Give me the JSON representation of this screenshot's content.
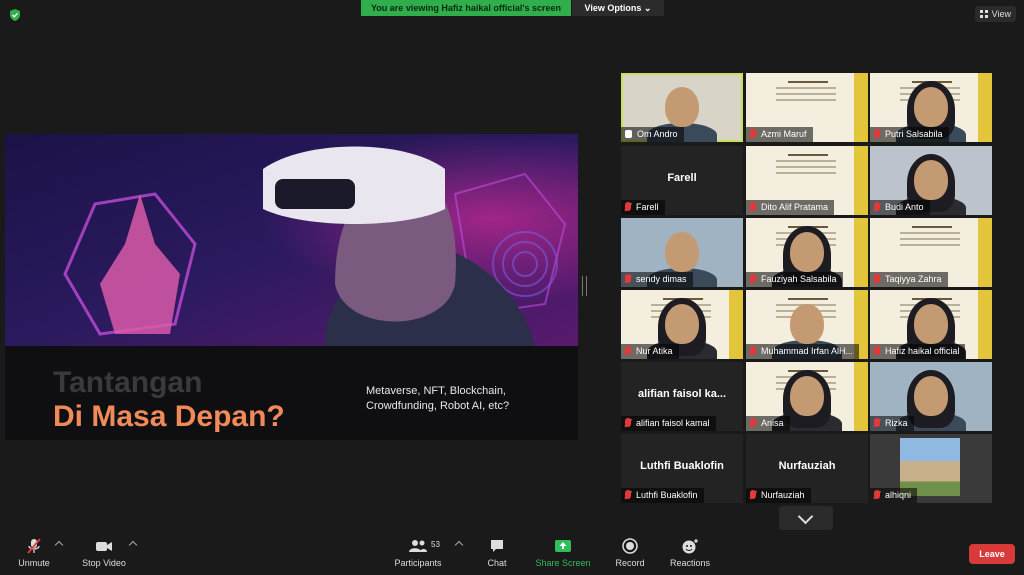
{
  "banner": {
    "viewing_text": "You are viewing Hafiz haikal official's screen",
    "view_options": "View Options"
  },
  "top_right": {
    "view_label": "View"
  },
  "slide": {
    "title_line1": "Tantangan",
    "title_line2": "Di Masa Depan?",
    "subtitle": "Metaverse, NFT, Blockchain, Crowdfunding, Robot AI, etc?"
  },
  "participants": [
    {
      "name": "Om Andro",
      "type": "video",
      "muted": false,
      "pinned": true,
      "active": true
    },
    {
      "name": "Azmi Maruf",
      "type": "poster",
      "muted": true
    },
    {
      "name": "Putri Salsabila",
      "type": "poster-person",
      "muted": true
    },
    {
      "name": "Farell",
      "type": "blank",
      "muted": true
    },
    {
      "name": "Dito Alif Pratama",
      "type": "poster",
      "muted": true
    },
    {
      "name": "Budi Anto",
      "type": "video",
      "muted": true
    },
    {
      "name": "sendy dimas",
      "type": "video",
      "muted": true
    },
    {
      "name": "Fauziyah Salsabila",
      "type": "poster-person",
      "muted": true
    },
    {
      "name": "Taqiyya Zahra",
      "type": "poster",
      "muted": true
    },
    {
      "name": "Nur Atika",
      "type": "poster-person",
      "muted": true
    },
    {
      "name": "Muhammad Irfan AlH...",
      "type": "poster-person",
      "muted": true
    },
    {
      "name": "Hafiz haikal official",
      "type": "poster-person",
      "muted": true
    },
    {
      "name": "alifian faisol kamal",
      "display": "alifian faisol ka...",
      "type": "blank",
      "muted": true
    },
    {
      "name": "Anisa",
      "type": "poster-person",
      "muted": true
    },
    {
      "name": "Rizka",
      "type": "video",
      "muted": true
    },
    {
      "name": "Luthfi Buaklofin",
      "type": "blank",
      "muted": true
    },
    {
      "name": "Nurfauziah",
      "type": "blank",
      "muted": true
    },
    {
      "name": "alhiqni",
      "type": "image",
      "muted": true
    }
  ],
  "toolbar": {
    "unmute": "Unmute",
    "stop_video": "Stop Video",
    "participants": "Participants",
    "participants_count": "53",
    "chat": "Chat",
    "share_screen": "Share Screen",
    "record": "Record",
    "reactions": "Reactions",
    "leave": "Leave"
  },
  "colors": {
    "share_green": "#2fae4b",
    "leave_red": "#d83a3a",
    "active_border": "#c9e05a",
    "title_accent": "#f08a58"
  },
  "icons": [
    "shield-icon",
    "grid-icon",
    "mic-muted-icon",
    "camera-icon",
    "participants-icon",
    "chat-icon",
    "share-screen-icon",
    "record-icon",
    "reactions-icon",
    "chevron-down-icon",
    "pin-icon"
  ]
}
